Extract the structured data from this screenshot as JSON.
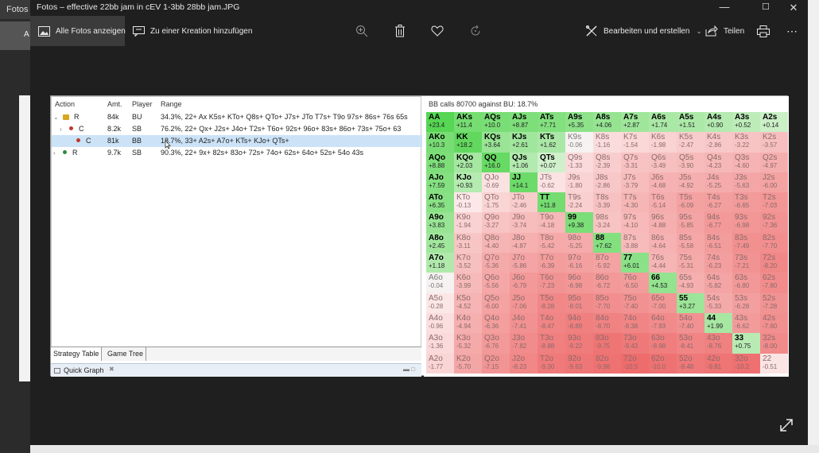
{
  "background": {
    "tab_label": "Fotos -",
    "side_label": "A"
  },
  "window": {
    "title": "Fotos – effective 22bb jam in cEV 1-3bb 28bb jam.JPG"
  },
  "toolbar": {
    "all_photos": "Alle Fotos anzeigen",
    "add_to_creation": "Zu einer Kreation hinzufügen",
    "edit_create": "Bearbeiten und erstellen",
    "share": "Teilen"
  },
  "tree": {
    "headers": {
      "action": "Action",
      "amount": "Amt.",
      "player": "Player",
      "range": "Range"
    },
    "rows": [
      {
        "action": "R",
        "amount": "84k",
        "player": "BU",
        "range": "34.3%, 22+ Ax K5s+ KTo+ Q8s+ QTo+ J7s+ JTo T7s+ T9o 97s+ 86s+ 76s 65s"
      },
      {
        "action": "C",
        "amount": "8.2k",
        "player": "SB",
        "range": "76.2%, 22+ Qx+ J2s+ J4o+ T2s+ T6o+ 92s+ 96o+ 83s+ 86o+ 73s+ 75o+ 63"
      },
      {
        "action": "C",
        "amount": "81k",
        "player": "BB",
        "range": "18.7%, 33+ A2s+ A7o+ KTs+ KJo+ QTs+"
      },
      {
        "action": "R",
        "amount": "9.7k",
        "player": "SB",
        "range": "90.3%, 22+ 9x+ 82s+ 83o+ 72s+ 74o+ 62s+ 64o+ 52s+ 54o 43s"
      }
    ],
    "tabs": [
      "Strategy Table",
      "Game Tree"
    ],
    "quick_graph": "Quick Graph"
  },
  "chart_data": {
    "type": "heatmap",
    "title": "BB calls 80700 against BU: 18.7%",
    "rows": [
      [
        [
          "AA",
          "+23.4"
        ],
        [
          "AKs",
          "+11.4"
        ],
        [
          "AQs",
          "+10.0"
        ],
        [
          "AJs",
          "+8.87"
        ],
        [
          "ATs",
          "+7.71"
        ],
        [
          "A9s",
          "+5.35"
        ],
        [
          "A8s",
          "+4.06"
        ],
        [
          "A7s",
          "+2.87"
        ],
        [
          "A6s",
          "+1.74"
        ],
        [
          "A5s",
          "+1.51"
        ],
        [
          "A4s",
          "+0.90"
        ],
        [
          "A3s",
          "+0.52"
        ],
        [
          "A2s",
          "+0.14"
        ]
      ],
      [
        [
          "AKo",
          "+10.3"
        ],
        [
          "KK",
          "+18.2"
        ],
        [
          "KQs",
          "+3.64"
        ],
        [
          "KJs",
          "+2.61"
        ],
        [
          "KTs",
          "+1.62"
        ],
        [
          "K9s",
          "-0.06"
        ],
        [
          "K8s",
          "-1.16"
        ],
        [
          "K7s",
          "-1.54"
        ],
        [
          "K6s",
          "-1.98"
        ],
        [
          "K5s",
          "-2.47"
        ],
        [
          "K4s",
          "-2.86"
        ],
        [
          "K3s",
          "-3.22"
        ],
        [
          "K2s",
          "-3.57"
        ]
      ],
      [
        [
          "AQo",
          "+8.88"
        ],
        [
          "KQo",
          "+2.03"
        ],
        [
          "QQ",
          "+16.0"
        ],
        [
          "QJs",
          "+1.06"
        ],
        [
          "QTs",
          "+0.07"
        ],
        [
          "Q9s",
          "-1.33"
        ],
        [
          "Q8s",
          "-2.39"
        ],
        [
          "Q7s",
          "-3.31"
        ],
        [
          "Q6s",
          "-3.49"
        ],
        [
          "Q5s",
          "-3.90"
        ],
        [
          "Q4s",
          "-4.23"
        ],
        [
          "Q3s",
          "-4.60"
        ],
        [
          "Q2s",
          "-4.97"
        ]
      ],
      [
        [
          "AJo",
          "+7.59"
        ],
        [
          "KJo",
          "+0.93"
        ],
        [
          "QJo",
          "-0.69"
        ],
        [
          "JJ",
          "+14.1"
        ],
        [
          "JTs",
          "-0.62"
        ],
        [
          "J9s",
          "-1.80"
        ],
        [
          "J8s",
          "-2.86"
        ],
        [
          "J7s",
          "-3.79"
        ],
        [
          "J6s",
          "-4.68"
        ],
        [
          "J5s",
          "-4.92"
        ],
        [
          "J4s",
          "-5.25"
        ],
        [
          "J3s",
          "-5.63"
        ],
        [
          "J2s",
          "-6.00"
        ]
      ],
      [
        [
          "ATo",
          "+6.35"
        ],
        [
          "KTo",
          "-0.13"
        ],
        [
          "QTo",
          "-1.75"
        ],
        [
          "JTo",
          "-2.46"
        ],
        [
          "TT",
          "+11.8"
        ],
        [
          "T9s",
          "-2.24"
        ],
        [
          "T8s",
          "-3.39"
        ],
        [
          "T7s",
          "-4.30"
        ],
        [
          "T6s",
          "-5.14"
        ],
        [
          "T5s",
          "-6.09"
        ],
        [
          "T4s",
          "-6.27"
        ],
        [
          "T3s",
          "-6.65"
        ],
        [
          "T2s",
          "-7.03"
        ]
      ],
      [
        [
          "A9o",
          "+3.83"
        ],
        [
          "K9o",
          "-1.94"
        ],
        [
          "Q9o",
          "-3.27"
        ],
        [
          "J9o",
          "-3.74"
        ],
        [
          "T9o",
          "-4.18"
        ],
        [
          "99",
          "+9.38"
        ],
        [
          "98s",
          "-3.24"
        ],
        [
          "97s",
          "-4.10"
        ],
        [
          "96s",
          "-4.88"
        ],
        [
          "95s",
          "-5.85"
        ],
        [
          "94s",
          "-6.77"
        ],
        [
          "93s",
          "-6.98"
        ],
        [
          "92s",
          "-7.36"
        ]
      ],
      [
        [
          "A8o",
          "+2.45"
        ],
        [
          "K8o",
          "-3.11"
        ],
        [
          "Q8o",
          "-4.40"
        ],
        [
          "J8o",
          "-4.87"
        ],
        [
          "T8o",
          "-5.42"
        ],
        [
          "98o",
          "-5.25"
        ],
        [
          "88",
          "+7.62"
        ],
        [
          "87s",
          "-3.88"
        ],
        [
          "86s",
          "-4.64"
        ],
        [
          "85s",
          "-5.58"
        ],
        [
          "84s",
          "-6.51"
        ],
        [
          "83s",
          "-7.49"
        ],
        [
          "82s",
          "-7.70"
        ]
      ],
      [
        [
          "A7o",
          "+1.18"
        ],
        [
          "K7o",
          "-3.52"
        ],
        [
          "Q7o",
          "-5.36"
        ],
        [
          "J7o",
          "-5.86"
        ],
        [
          "T7o",
          "-6.39"
        ],
        [
          "97o",
          "-6.16"
        ],
        [
          "87o",
          "-5.92"
        ],
        [
          "77",
          "+6.01"
        ],
        [
          "76s",
          "-4.44"
        ],
        [
          "75s",
          "-5.31"
        ],
        [
          "74s",
          "-6.23"
        ],
        [
          "73s",
          "-7.21"
        ],
        [
          "72s",
          "-8.20"
        ]
      ],
      [
        [
          "A6o",
          "-0.04"
        ],
        [
          "K6o",
          "-3.99"
        ],
        [
          "Q6o",
          "-5.56"
        ],
        [
          "J6o",
          "-6.79"
        ],
        [
          "T6o",
          "-7.23"
        ],
        [
          "96o",
          "-6.98"
        ],
        [
          "86o",
          "-6.72"
        ],
        [
          "76o",
          "-6.50"
        ],
        [
          "66",
          "+4.53"
        ],
        [
          "65s",
          "-4.93"
        ],
        [
          "64s",
          "-5.82"
        ],
        [
          "63s",
          "-6.80"
        ],
        [
          "62s",
          "-7.80"
        ]
      ],
      [
        [
          "A5o",
          "-0.28"
        ],
        [
          "K5o",
          "-4.52"
        ],
        [
          "Q5o",
          "-6.00"
        ],
        [
          "J5o",
          "-7.06"
        ],
        [
          "T5o",
          "-8.28"
        ],
        [
          "95o",
          "-8.01"
        ],
        [
          "85o",
          "-7.70"
        ],
        [
          "75o",
          "-7.40"
        ],
        [
          "65o",
          "-7.00"
        ],
        [
          "55",
          "+3.27"
        ],
        [
          "54s",
          "-5.33"
        ],
        [
          "53s",
          "-6.28"
        ],
        [
          "52s",
          "-7.28"
        ]
      ],
      [
        [
          "A4o",
          "-0.96"
        ],
        [
          "K4o",
          "-4.94"
        ],
        [
          "Q4o",
          "-6.36"
        ],
        [
          "J4o",
          "-7.41"
        ],
        [
          "T4o",
          "-8.47"
        ],
        [
          "94o",
          "-8.89"
        ],
        [
          "84o",
          "-8.70"
        ],
        [
          "74o",
          "-8.38"
        ],
        [
          "64o",
          "-7.93"
        ],
        [
          "54o",
          "-7.40"
        ],
        [
          "44",
          "+1.99"
        ],
        [
          "43s",
          "-6.62"
        ],
        [
          "42s",
          "-7.60"
        ]
      ],
      [
        [
          "A3o",
          "-1.36"
        ],
        [
          "K3o",
          "-5.32"
        ],
        [
          "Q3o",
          "-6.76"
        ],
        [
          "J3o",
          "-7.82"
        ],
        [
          "T3o",
          "-8.88"
        ],
        [
          "93o",
          "-9.22"
        ],
        [
          "83o",
          "-9.75"
        ],
        [
          "73o",
          "-9.43"
        ],
        [
          "63o",
          "-8.98"
        ],
        [
          "53o",
          "-8.41"
        ],
        [
          "43o",
          "-8.76"
        ],
        [
          "33",
          "+0.75"
        ],
        [
          "32s",
          "-8.00"
        ]
      ],
      [
        [
          "A2o",
          "-1.77"
        ],
        [
          "K2o",
          "-5.70"
        ],
        [
          "Q2o",
          "-7.15"
        ],
        [
          "J2o",
          "-8.23"
        ],
        [
          "T2o",
          "-9.30"
        ],
        [
          "92o",
          "-9.63"
        ],
        [
          "82o",
          "-9.98"
        ],
        [
          "72o",
          "-10.5"
        ],
        [
          "62o",
          "-10.0"
        ],
        [
          "52o",
          "-9.48"
        ],
        [
          "42o",
          "-9.81"
        ],
        [
          "32o",
          "-10.2"
        ],
        [
          "22",
          "-0.51"
        ]
      ]
    ]
  }
}
